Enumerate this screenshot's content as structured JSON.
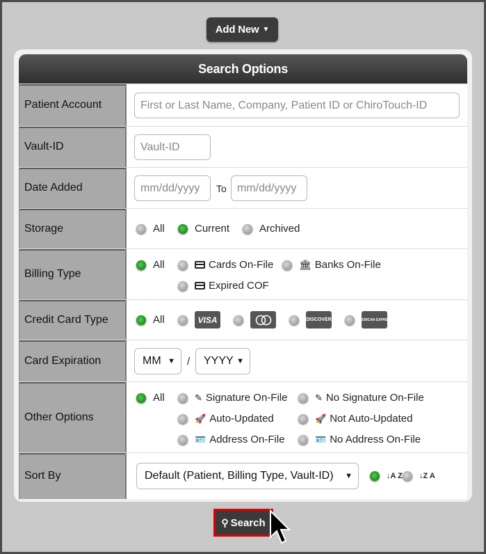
{
  "toolbar": {
    "add_new_label": "Add New"
  },
  "panel": {
    "title": "Search Options"
  },
  "fields": {
    "patient_account": {
      "label": "Patient Account",
      "placeholder": "First or Last Name, Company, Patient ID or ChiroTouch-ID"
    },
    "vault_id": {
      "label": "Vault-ID",
      "placeholder": "Vault-ID"
    },
    "date_added": {
      "label": "Date Added",
      "from_placeholder": "mm/dd/yyyy",
      "to_label": "To",
      "to_placeholder": "mm/dd/yyyy"
    },
    "storage": {
      "label": "Storage",
      "options": [
        "All",
        "Current",
        "Archived"
      ],
      "selected": "Current"
    },
    "billing_type": {
      "label": "Billing Type",
      "options": [
        "All",
        "Cards On-File",
        "Banks On-File",
        "Expired COF"
      ],
      "selected": "All"
    },
    "credit_card_type": {
      "label": "Credit Card Type",
      "options": [
        "All",
        "VISA",
        "Mastercard",
        "Discover",
        "American Express"
      ],
      "brand_text": {
        "visa": "VISA",
        "discover": "DISCOVER",
        "amex": "AMERICAN EXPRESS"
      },
      "selected": "All"
    },
    "card_expiration": {
      "label": "Card Expiration",
      "month": "MM",
      "separator": "/",
      "year": "YYYY"
    },
    "other_options": {
      "label": "Other Options",
      "options": [
        "All",
        "Signature On-File",
        "No Signature On-File",
        "Auto-Updated",
        "Not Auto-Updated",
        "Address On-File",
        "No Address On-File"
      ],
      "selected": "All"
    },
    "sort_by": {
      "label": "Sort By",
      "value": "Default (Patient, Billing Type, Vault-ID)",
      "asc_glyph": "↓A Z",
      "desc_glyph": "↓Z A"
    }
  },
  "search_button_label": "Search",
  "colors": {
    "selected_radio": "#2fb82f",
    "highlight_border": "#e00000",
    "header_bg": "#3a3a3a"
  }
}
